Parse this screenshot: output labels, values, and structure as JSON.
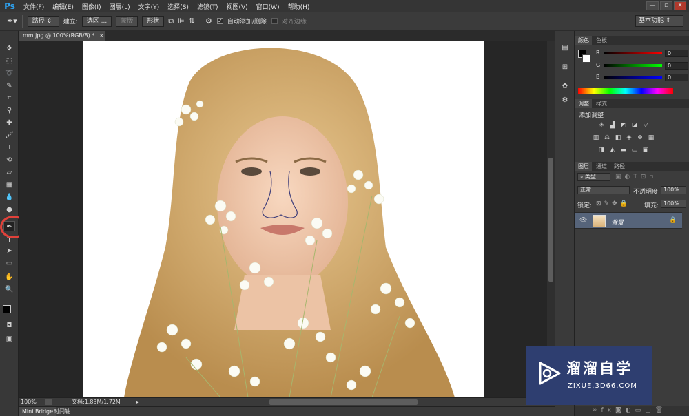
{
  "menubar": {
    "logo": "Ps",
    "items": [
      "文件(F)",
      "编辑(E)",
      "图像(I)",
      "图层(L)",
      "文字(Y)",
      "选择(S)",
      "滤镜(T)",
      "视图(V)",
      "窗口(W)",
      "帮助(H)"
    ],
    "window_controls": [
      "—",
      "▫",
      "✕"
    ]
  },
  "options": {
    "path_mode": "路径",
    "make_label": "建立:",
    "selection_btn": "选区 ...",
    "mask_btn": "蒙版",
    "shape_btn": "形状",
    "auto_add_delete": "自动添加/删除",
    "align_edges": "对齐边缘",
    "workspace": "基本功能"
  },
  "document": {
    "tab_title": "mm.jpg @ 100%(RGB/8) *",
    "zoom": "100%",
    "doc_info": "文档:1.83M/1.72M"
  },
  "bottom_tabs": [
    "Mini Bridge",
    "时间轴"
  ],
  "color_panel": {
    "tabs": [
      "颜色",
      "色板"
    ],
    "channels": [
      {
        "label": "R",
        "value": "0"
      },
      {
        "label": "G",
        "value": "0"
      },
      {
        "label": "B",
        "value": "0"
      }
    ]
  },
  "adjust_panel": {
    "tabs": [
      "调整",
      "样式"
    ],
    "heading": "添加调整"
  },
  "layers_panel": {
    "tabs": [
      "图层",
      "通道",
      "路径"
    ],
    "filter": "类型",
    "blend_mode": "正常",
    "opacity_label": "不透明度:",
    "opacity": "100%",
    "lock_label": "锁定:",
    "fill_label": "填充:",
    "fill": "100%",
    "layer_name": "背景"
  },
  "watermark": {
    "title": "溜溜自学",
    "url": "ZIXUE.3D66.COM"
  },
  "colors": {
    "accent_red": "#e0413a",
    "selected_layer": "#56647a",
    "watermark_bg": "#2e3e70"
  }
}
